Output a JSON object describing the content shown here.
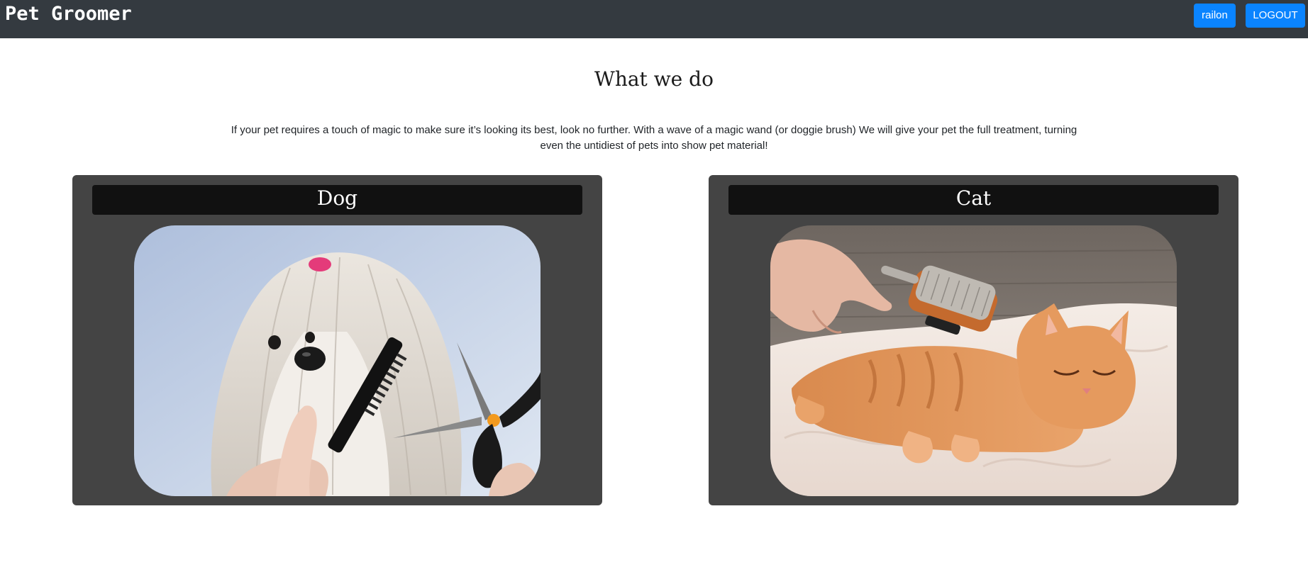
{
  "app": {
    "brand": "Pet Groomer",
    "user_button": "railon",
    "logout_button": "LOGOUT"
  },
  "main": {
    "heading": "What we do",
    "intro": "If your pet requires a touch of magic to make sure it’s looking its best, look no further. With a wave of a magic wand (or doggie brush) We will give your pet the full treatment, turning even the untidiest of pets into show pet material!"
  },
  "cards": [
    {
      "title": "Dog",
      "image": "dog-grooming-photo"
    },
    {
      "title": "Cat",
      "image": "cat-brushing-photo"
    }
  ],
  "colors": {
    "navbar": "#343a40",
    "button": "#0a84ff",
    "card_bg": "#444444",
    "card_title_bg": "#111111"
  }
}
